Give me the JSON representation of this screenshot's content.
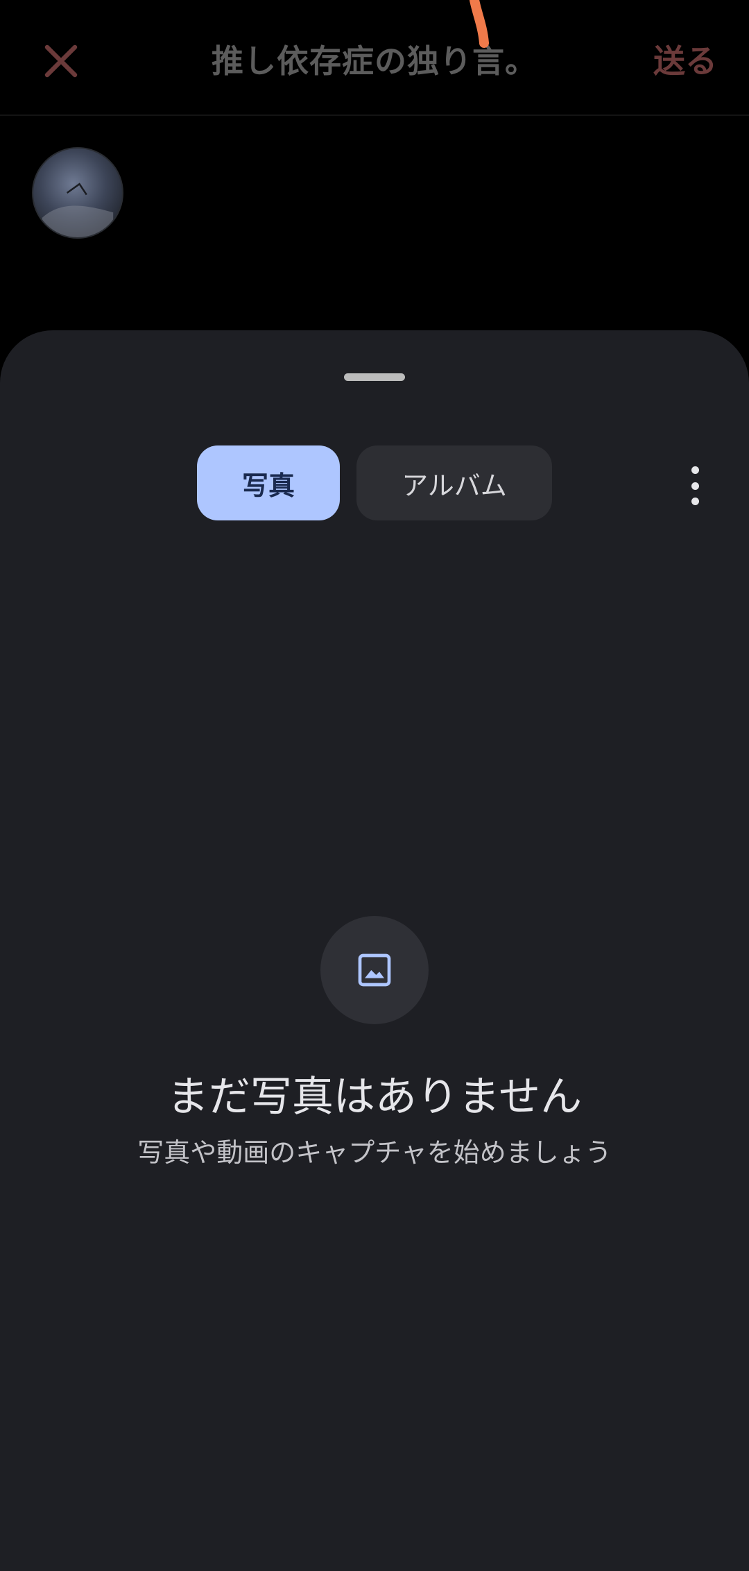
{
  "header": {
    "title": "推し依存症の独り言。",
    "send_label": "送る",
    "close_icon": "close-icon"
  },
  "colors": {
    "sheet_background": "#1e1f24",
    "selected_tab": "#aec6ff",
    "unselected_tab": "#2d2e33",
    "close_icon": "#6b3a3a",
    "accent_stroke": "#f07a4a"
  },
  "picker": {
    "tabs": [
      {
        "label": "写真",
        "selected": true
      },
      {
        "label": "アルバム",
        "selected": false
      }
    ],
    "more_icon": "more-vert-icon"
  },
  "empty_state": {
    "icon": "image-icon",
    "title": "まだ写真はありません",
    "subtitle": "写真や動画のキャプチャを始めましょう"
  }
}
